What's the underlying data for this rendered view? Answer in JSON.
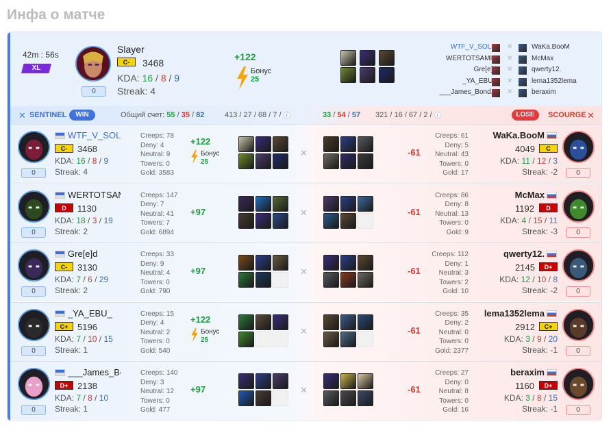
{
  "title": "Инфа о матче",
  "summary": {
    "duration": "42m : 56s",
    "badge": "XL",
    "mvp": {
      "name": "Slayer",
      "rank": "C-",
      "rating": "3468",
      "kda_label": "KDA:",
      "k": "16",
      "d": "8",
      "a": "9",
      "streak": "Streak: 4",
      "score": "0",
      "gain": "+122",
      "bonus_label": "Бонус",
      "bonus_value": "25"
    },
    "mvp_items": [
      "#c9c2a8",
      "#3a2d7a",
      "#5b4833",
      "#6d8a2a",
      "#4a3c6e",
      "#1e2a6a"
    ],
    "players_left": [
      "WTF_V_SOLO",
      "WERTOTSAMIY",
      "Gre[e]d",
      "_YA_EBU_",
      "___James_Bond..."
    ],
    "players_right": [
      "WaKa.BooM",
      "McMax",
      "qwerty12.",
      "lema1352lema",
      "beraxim"
    ]
  },
  "bar": {
    "sentinel": "SENTINEL",
    "win": "WIN",
    "total_label": "Общий счет:",
    "s_k": "55",
    "s_d": "35",
    "s_a": "82",
    "s_extra": "413 / 27 / 68 / 7 /",
    "sc_k": "33",
    "sc_d": "54",
    "sc_a": "57",
    "sc_extra": "321 / 16 / 67 / 2 /",
    "lose": "LOSE",
    "scourge": "SCOURGE",
    "info": "i"
  },
  "labels": {
    "kda": "KDA:",
    "sep": "/"
  },
  "rows": [
    {
      "left": {
        "name": "WTF_V_SOLO",
        "name_link": true,
        "rank": "C-",
        "rank_type": "cm",
        "rating": "3468",
        "k": "16",
        "d": "8",
        "a": "9",
        "streak": "Streak: 4",
        "score": "0",
        "stats": [
          "Creeps: 78",
          "Deny: 4",
          "Neutral: 9",
          "Towers: 0",
          "Gold: 3583"
        ],
        "gain": "+122",
        "bonus": true,
        "bonus_label": "Бонус",
        "bonus_value": "25",
        "items": [
          "#c9c2a8",
          "#3a2d7a",
          "#5b4833",
          "#6d8a2a",
          "#4a3c6e",
          "#1e2a6a"
        ],
        "hero": "#7a1c3a"
      },
      "right": {
        "name": "WaKa.BooM",
        "rank": "C",
        "rank_type": "cm",
        "rating": "4049",
        "k": "11",
        "d": "12",
        "a": "3",
        "streak": "Streak: -2",
        "score": "0",
        "stats": [
          "Creeps: 61",
          "Deny: 5",
          "Neutral: 43",
          "Towers: 0",
          "Gold: 17"
        ],
        "loss": "-61",
        "items": [
          "#4b3a2a",
          "#2a3f8a",
          "#555a60",
          "#6f6a60",
          "#2d2a6b",
          "#3a3a3a"
        ],
        "hero": "#2b4f9a"
      }
    },
    {
      "left": {
        "name": "WERTOTSAMIY",
        "name_link": false,
        "rank": "D",
        "rank_type": "dd",
        "rating": "1130",
        "k": "18",
        "d": "3",
        "a": "19",
        "streak": "Streak: 2",
        "score": "0",
        "stats": [
          "Creeps: 147",
          "Deny: 7",
          "Neutral: 41",
          "Towers: 7",
          "Gold: 6894"
        ],
        "gain": "+97",
        "bonus": false,
        "items": [
          "#3a2a5a",
          "#1d6fc0",
          "#5a6a30",
          "#4a3a30",
          "#3a2d7a",
          "#2a4a8a"
        ],
        "hero": "#2d4a1e"
      },
      "right": {
        "name": "McMax",
        "rank": "D",
        "rank_type": "dd",
        "rating": "1192",
        "k": "4",
        "d": "15",
        "a": "11",
        "streak": "Streak: -3",
        "score": "0",
        "stats": [
          "Creeps: 86",
          "Deny: 8",
          "Neutral: 13",
          "Towers: 0",
          "Gold: 9"
        ],
        "loss": "-61",
        "items": [
          "#4a3c6e",
          "#2a3f8a",
          "#3a6aa0",
          "#2a5a8a",
          "#5b4833",
          "empty"
        ],
        "hero": "#3f8a2a"
      }
    },
    {
      "left": {
        "name": "Gre[e]d",
        "name_link": false,
        "rank": "C-",
        "rank_type": "cm",
        "rating": "3130",
        "k": "7",
        "d": "6",
        "a": "29",
        "streak": "Streak: 2",
        "score": "0",
        "stats": [
          "Creeps: 33",
          "Deny: 9",
          "Neutral: 4",
          "Towers: 0",
          "Gold: 790"
        ],
        "gain": "+97",
        "bonus": false,
        "items": [
          "#7a4a1a",
          "#2a3f8a",
          "#6a5a40",
          "#2a7a3a",
          "#1a3a5a",
          "empty"
        ],
        "hero": "#3a2a5a"
      },
      "right": {
        "name": "qwerty12.",
        "rank": "D+",
        "rank_type": "dd",
        "rating": "2145",
        "k": "12",
        "d": "10",
        "a": "8",
        "streak": "Streak: -2",
        "score": "0",
        "stats": [
          "Creeps: 112",
          "Deny: 1",
          "Neutral: 3",
          "Towers: 2",
          "Gold: 10"
        ],
        "loss": "-61",
        "items": [
          "#3a2d7a",
          "#2a3f8a",
          "#5b4833",
          "#555a60",
          "#8a3a1a",
          "#6f6a60"
        ],
        "hero": "#3a5a7a"
      }
    },
    {
      "left": {
        "name": "_YA_EBU_",
        "name_link": false,
        "rank": "C+",
        "rank_type": "cm",
        "rating": "5196",
        "k": "7",
        "d": "10",
        "a": "15",
        "streak": "Streak: 1",
        "score": "0",
        "stats": [
          "Creeps: 15",
          "Deny: 4",
          "Neutral: 2",
          "Towers: 0",
          "Gold: 540"
        ],
        "gain": "+122",
        "bonus": true,
        "bonus_label": "Бонус",
        "bonus_value": "25",
        "items": [
          "#2a7a3a",
          "#5a4a3a",
          "#3a2d7a",
          "#3a8a2a",
          "empty",
          "empty"
        ],
        "hero": "#2a2a2a"
      },
      "right": {
        "name": "lema1352lema",
        "rank": "C+",
        "rank_type": "cm",
        "rating": "2912",
        "k": "3",
        "d": "9",
        "a": "20",
        "streak": "Streak: -1",
        "score": "0",
        "stats": [
          "Creeps: 35",
          "Deny: 2",
          "Neutral: 0",
          "Towers: 0",
          "Gold: 2377"
        ],
        "loss": "-61",
        "items": [
          "#5b4833",
          "#3a5a8a",
          "#2a4a7a",
          "#6a5a40",
          "#4a6a8a",
          "empty"
        ],
        "hero": "#5a3a2a"
      }
    },
    {
      "left": {
        "name": "___James_Bond",
        "name_link": false,
        "rank": "D+",
        "rank_type": "dd",
        "rating": "2138",
        "k": "7",
        "d": "8",
        "a": "10",
        "streak": "Streak: 1",
        "score": "0",
        "stats": [
          "Creeps: 140",
          "Deny: 3",
          "Neutral: 12",
          "Towers: 0",
          "Gold: 477"
        ],
        "gain": "+97",
        "bonus": false,
        "items": [
          "#3a2d7a",
          "#2a3f8a",
          "#4a3c6e",
          "#1d5ac0",
          "#4a3a30",
          "empty"
        ],
        "hero": "#e8a0c8"
      },
      "right": {
        "name": "beraxim",
        "rank": "D+",
        "rank_type": "dd",
        "rating": "1160",
        "k": "3",
        "d": "8",
        "a": "15",
        "streak": "Streak: -1",
        "score": "0",
        "stats": [
          "Creeps: 27",
          "Deny: 0",
          "Neutral: 8",
          "Towers: 0",
          "Gold: 16"
        ],
        "loss": "-61",
        "items": [
          "#3a2d7a",
          "#c9b04a",
          "#d8c8a0",
          "#555a60",
          "#4a4a4a",
          "#3a4a6a"
        ],
        "hero": "#6a4a2a"
      }
    }
  ]
}
